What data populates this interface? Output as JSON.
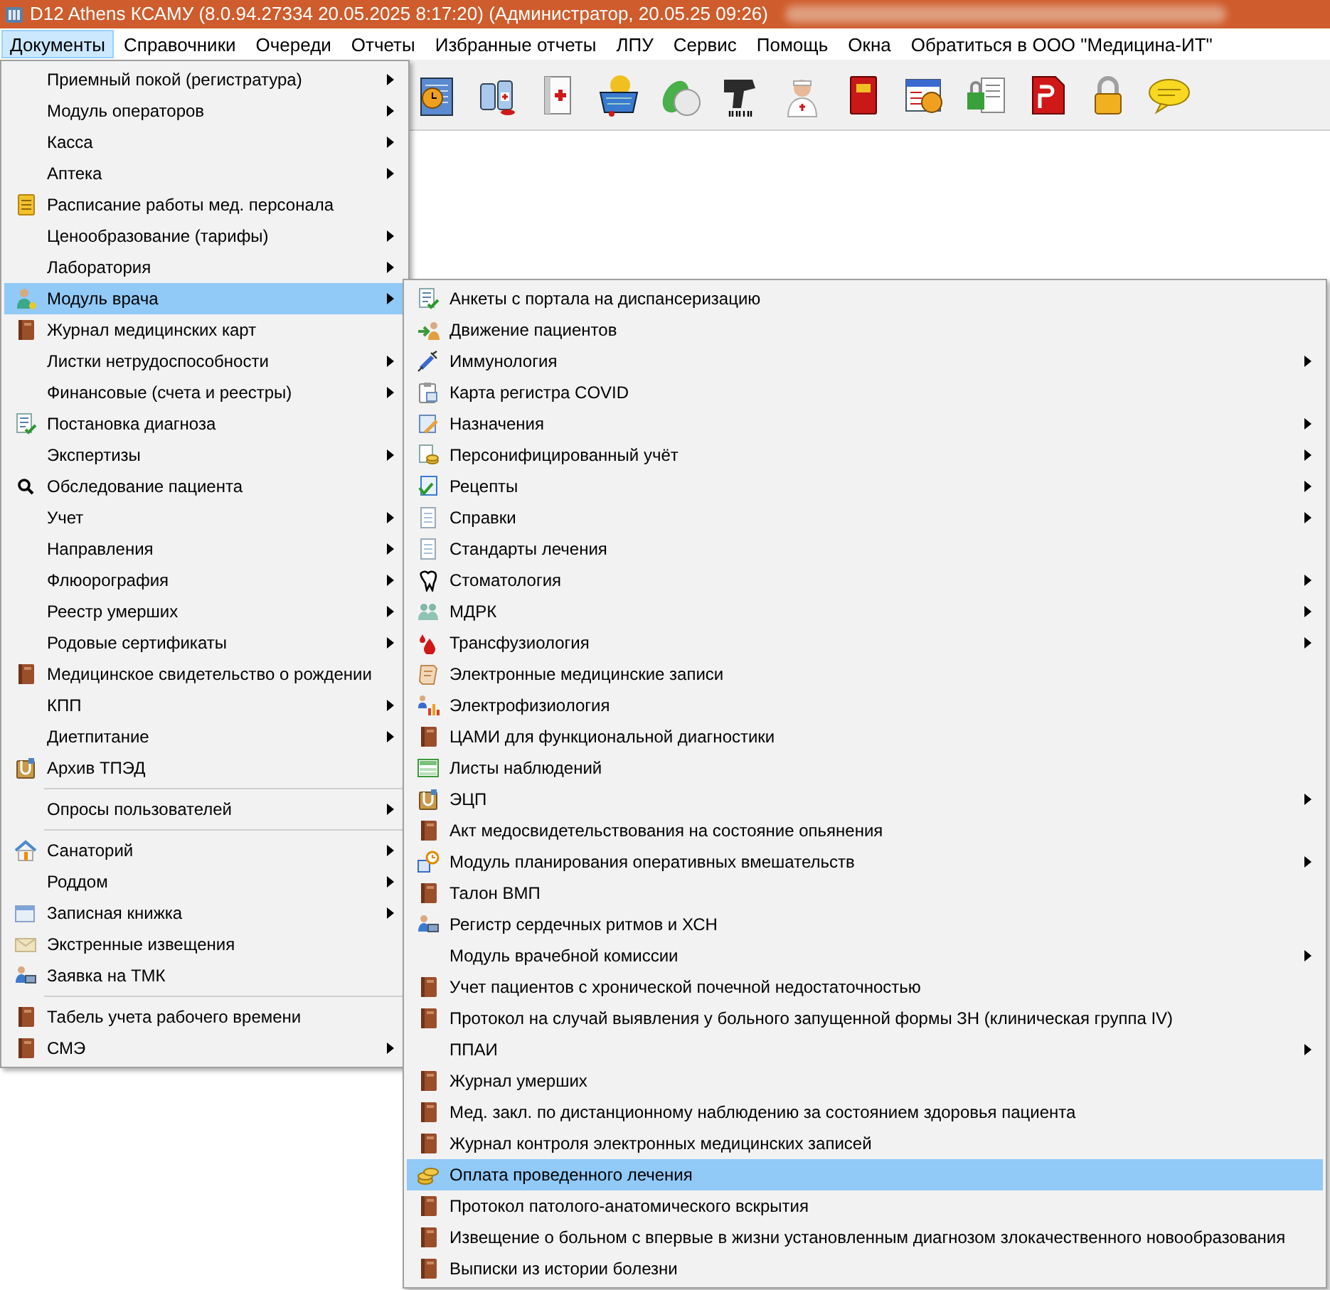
{
  "window": {
    "title": "D12 Athens КСАМУ (8.0.94.27334 20.05.2025 8:17:20) (Администратор, 20.05.25 09:26)"
  },
  "menu_bar": [
    {
      "label": "Документы",
      "selected": true
    },
    {
      "label": "Справочники",
      "selected": false
    },
    {
      "label": "Очереди",
      "selected": false
    },
    {
      "label": "Отчеты",
      "selected": false
    },
    {
      "label": "Избранные отчеты",
      "selected": false
    },
    {
      "label": "ЛПУ",
      "selected": false
    },
    {
      "label": "Сервис",
      "selected": false
    },
    {
      "label": "Помощь",
      "selected": false
    },
    {
      "label": "Окна",
      "selected": false
    },
    {
      "label": "Обратиться в ООО \"Медицина-ИТ\"",
      "selected": false
    }
  ],
  "documents_menu": [
    {
      "label": "Приемный покой (регистратура)",
      "submenu": true,
      "selected": false,
      "separator_before": false
    },
    {
      "label": "Модуль операторов",
      "submenu": true,
      "selected": false,
      "separator_before": false
    },
    {
      "label": "Касса",
      "submenu": true,
      "selected": false,
      "separator_before": false
    },
    {
      "label": "Аптека",
      "submenu": true,
      "selected": false,
      "separator_before": false
    },
    {
      "label": "Расписание работы мед. персонала",
      "submenu": false,
      "selected": false,
      "separator_before": false
    },
    {
      "label": "Ценообразование (тарифы)",
      "submenu": true,
      "selected": false,
      "separator_before": false
    },
    {
      "label": "Лаборатория",
      "submenu": true,
      "selected": false,
      "separator_before": false
    },
    {
      "label": "Модуль врача",
      "submenu": true,
      "selected": true,
      "separator_before": false
    },
    {
      "label": "Журнал медицинских карт",
      "submenu": false,
      "selected": false,
      "separator_before": false
    },
    {
      "label": "Листки нетрудоспособности",
      "submenu": true,
      "selected": false,
      "separator_before": false
    },
    {
      "label": "Финансовые (счета и реестры)",
      "submenu": true,
      "selected": false,
      "separator_before": false
    },
    {
      "label": "Постановка диагноза",
      "submenu": false,
      "selected": false,
      "separator_before": false
    },
    {
      "label": "Экспертизы",
      "submenu": true,
      "selected": false,
      "separator_before": false
    },
    {
      "label": "Обследование пациента",
      "submenu": false,
      "selected": false,
      "separator_before": false
    },
    {
      "label": "Учет",
      "submenu": true,
      "selected": false,
      "separator_before": false
    },
    {
      "label": "Направления",
      "submenu": true,
      "selected": false,
      "separator_before": false
    },
    {
      "label": "Флюорография",
      "submenu": true,
      "selected": false,
      "separator_before": false
    },
    {
      "label": "Реестр умерших",
      "submenu": true,
      "selected": false,
      "separator_before": false
    },
    {
      "label": "Родовые сертификаты",
      "submenu": true,
      "selected": false,
      "separator_before": false
    },
    {
      "label": "Медицинское свидетельство о рождении",
      "submenu": false,
      "selected": false,
      "separator_before": false
    },
    {
      "label": "КПП",
      "submenu": true,
      "selected": false,
      "separator_before": false
    },
    {
      "label": "Диетпитание",
      "submenu": true,
      "selected": false,
      "separator_before": false
    },
    {
      "label": "Архив ТПЭД",
      "submenu": false,
      "selected": false,
      "separator_before": false
    },
    {
      "label": "Опросы пользователей",
      "submenu": true,
      "selected": false,
      "separator_before": true
    },
    {
      "label": "Санаторий",
      "submenu": true,
      "selected": false,
      "separator_before": true
    },
    {
      "label": "Роддом",
      "submenu": true,
      "selected": false,
      "separator_before": false
    },
    {
      "label": "Записная книжка",
      "submenu": true,
      "selected": false,
      "separator_before": false
    },
    {
      "label": "Экстренные извещения",
      "submenu": false,
      "selected": false,
      "separator_before": false
    },
    {
      "label": "Заявка на ТМК",
      "submenu": false,
      "selected": false,
      "separator_before": false
    },
    {
      "label": "Табель учета рабочего времени",
      "submenu": false,
      "selected": false,
      "separator_before": true
    },
    {
      "label": "СМЭ",
      "submenu": true,
      "selected": false,
      "separator_before": false
    }
  ],
  "doctor_module_menu": [
    {
      "label": "Анкеты с портала на диспансеризацию",
      "submenu": false,
      "selected": false
    },
    {
      "label": "Движение пациентов",
      "submenu": false,
      "selected": false
    },
    {
      "label": "Иммунология",
      "submenu": true,
      "selected": false
    },
    {
      "label": "Карта регистра COVID",
      "submenu": false,
      "selected": false
    },
    {
      "label": "Назначения",
      "submenu": true,
      "selected": false
    },
    {
      "label": "Персонифицированный учёт",
      "submenu": true,
      "selected": false
    },
    {
      "label": "Рецепты",
      "submenu": true,
      "selected": false
    },
    {
      "label": "Справки",
      "submenu": true,
      "selected": false
    },
    {
      "label": "Стандарты лечения",
      "submenu": false,
      "selected": false
    },
    {
      "label": "Стоматология",
      "submenu": true,
      "selected": false
    },
    {
      "label": "МДРК",
      "submenu": true,
      "selected": false
    },
    {
      "label": "Трансфузиология",
      "submenu": true,
      "selected": false
    },
    {
      "label": "Электронные медицинские записи",
      "submenu": false,
      "selected": false
    },
    {
      "label": "Электрофизиология",
      "submenu": false,
      "selected": false
    },
    {
      "label": "ЦАМИ для функциональной диагностики",
      "submenu": false,
      "selected": false
    },
    {
      "label": "Листы наблюдений",
      "submenu": false,
      "selected": false
    },
    {
      "label": "ЭЦП",
      "submenu": true,
      "selected": false
    },
    {
      "label": "Акт медосвидетельствования на состояние опьянения",
      "submenu": false,
      "selected": false
    },
    {
      "label": "Модуль планирования оперативных вмешательств",
      "submenu": true,
      "selected": false
    },
    {
      "label": "Талон ВМП",
      "submenu": false,
      "selected": false
    },
    {
      "label": "Регистр сердечных ритмов и ХСН",
      "submenu": false,
      "selected": false
    },
    {
      "label": "Модуль врачебной комиссии",
      "submenu": true,
      "selected": false
    },
    {
      "label": "Учет пациентов с хронической почечной недостаточностью",
      "submenu": false,
      "selected": false
    },
    {
      "label": "Протокол на случай выявления у больного запущенной формы ЗН (клиническая группа IV)",
      "submenu": false,
      "selected": false
    },
    {
      "label": "ППАИ",
      "submenu": true,
      "selected": false
    },
    {
      "label": "Журнал умерших",
      "submenu": false,
      "selected": false
    },
    {
      "label": "Мед. закл. по дистанционному наблюдению за состоянием здоровья пациента",
      "submenu": false,
      "selected": false
    },
    {
      "label": "Журнал контроля электронных медицинских записей",
      "submenu": false,
      "selected": false
    },
    {
      "label": "Оплата проведенного лечения",
      "submenu": false,
      "selected": true
    },
    {
      "label": "Протокол патолого-анатомического вскрытия",
      "submenu": false,
      "selected": false
    },
    {
      "label": "Извещение о больном с впервые в жизни установленным диагнозом злокачественного новообразования",
      "submenu": false,
      "selected": false
    },
    {
      "label": "Выписки из истории болезни",
      "submenu": false,
      "selected": false
    }
  ]
}
